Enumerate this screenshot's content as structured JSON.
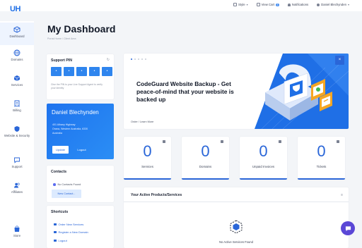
{
  "app": {
    "logo": "UH"
  },
  "topbar": {
    "style_label": "Style",
    "cart_label": "View Cart",
    "cart_count": "1",
    "notifications_label": "Notifications",
    "user_label": "Daniel Blechynden"
  },
  "sidebar": {
    "items": [
      {
        "label": "Dashboard",
        "icon": "dashboard-icon",
        "active": true
      },
      {
        "label": "Domains",
        "icon": "globe-icon"
      },
      {
        "label": "Services",
        "icon": "cube-icon"
      },
      {
        "label": "Billing",
        "icon": "receipt-icon"
      },
      {
        "label": "Website & Security",
        "icon": "shield-icon"
      },
      {
        "label": "Support",
        "icon": "chat-icon"
      },
      {
        "label": "Affiliates",
        "icon": "users-icon"
      },
      {
        "label": "Store",
        "icon": "store-icon"
      }
    ]
  },
  "page": {
    "title": "My Dashboard",
    "breadcrumb": "Portal Home / Client Area"
  },
  "support_pin": {
    "title": "Support PIN",
    "digits": [
      "•",
      "•",
      "•",
      "•",
      "•",
      "•"
    ],
    "help": "Give the PIN to your Live Support Agent to verify your identity"
  },
  "user_card": {
    "name": "Daniel Blechynden",
    "address_lines": [
      "401 Albany Highway",
      "Orana, Western Australia, 6330",
      "Australia"
    ],
    "update_label": "Update",
    "logout_label": "Logout"
  },
  "contacts": {
    "title": "Contacts",
    "empty": "No Contacts Found",
    "new_label": "New Contact..."
  },
  "shortcuts": {
    "title": "Shortcuts",
    "items": [
      "Order New Services",
      "Register a New Domain",
      "Logout"
    ]
  },
  "banner": {
    "title": "CodeGuard Website Backup - Get peace-of-mind that your website is backed up",
    "link": "Order / Learn More",
    "close": "×"
  },
  "stats": [
    {
      "value": "0",
      "label": "Services"
    },
    {
      "value": "0",
      "label": "Domains"
    },
    {
      "value": "0",
      "label": "Unpaid Invoices"
    },
    {
      "value": "0",
      "label": "Tickets"
    }
  ],
  "products": {
    "title": "Your Active Products/Services",
    "empty": "No Active Services Found"
  },
  "colors": {
    "accent": "#2a66d8",
    "chat": "#5a47d6"
  }
}
